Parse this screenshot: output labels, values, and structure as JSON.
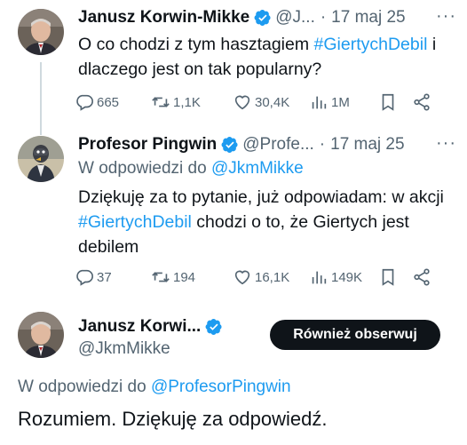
{
  "tweet1": {
    "name": "Janusz Korwin-Mikke",
    "handle": "@J...",
    "date": "17 maj 25",
    "text_part1": "O co chodzi z tym hasztagiem ",
    "hashtag": "#GiertychDebil",
    "text_part2": " i dlaczego jest on tak popularny?",
    "stats": {
      "replies": "665",
      "retweets": "1,1K",
      "likes": "30,4K",
      "views": "1M"
    }
  },
  "tweet2": {
    "name": "Profesor Pingwin",
    "handle": "@Profe...",
    "date": "17 maj 25",
    "reply_prefix": "W odpowiedzi do ",
    "reply_handle": "@JkmMikke",
    "text_part1": "Dziękuję za to pytanie, już odpowiadam: w akcji ",
    "hashtag": "#GiertychDebil",
    "text_part2": " chodzi o to, że Giertych jest debilem",
    "stats": {
      "replies": "37",
      "retweets": "194",
      "likes": "16,1K",
      "views": "149K"
    }
  },
  "tweet3": {
    "name": "Janusz Korwi...",
    "handle": "@JkmMikke",
    "follow_label": "Również obserwuj",
    "reply_prefix": "W odpowiedzi do ",
    "reply_handle": "@ProfesorPingwin",
    "text": "Rozumiem. Dziękuję za odpowiedź."
  },
  "icons": {
    "more": "more-dots-icon",
    "reply": "reply-bubble-icon",
    "retweet": "retweet-arrows-icon",
    "like": "heart-icon",
    "views": "bar-chart-icon",
    "bookmark": "bookmark-icon",
    "share": "share-icon",
    "verified": "verified-badge-icon"
  },
  "colors": {
    "accent": "#1d9bf0",
    "text": "#0f1419",
    "muted": "#536471",
    "button": "#0f1419"
  }
}
